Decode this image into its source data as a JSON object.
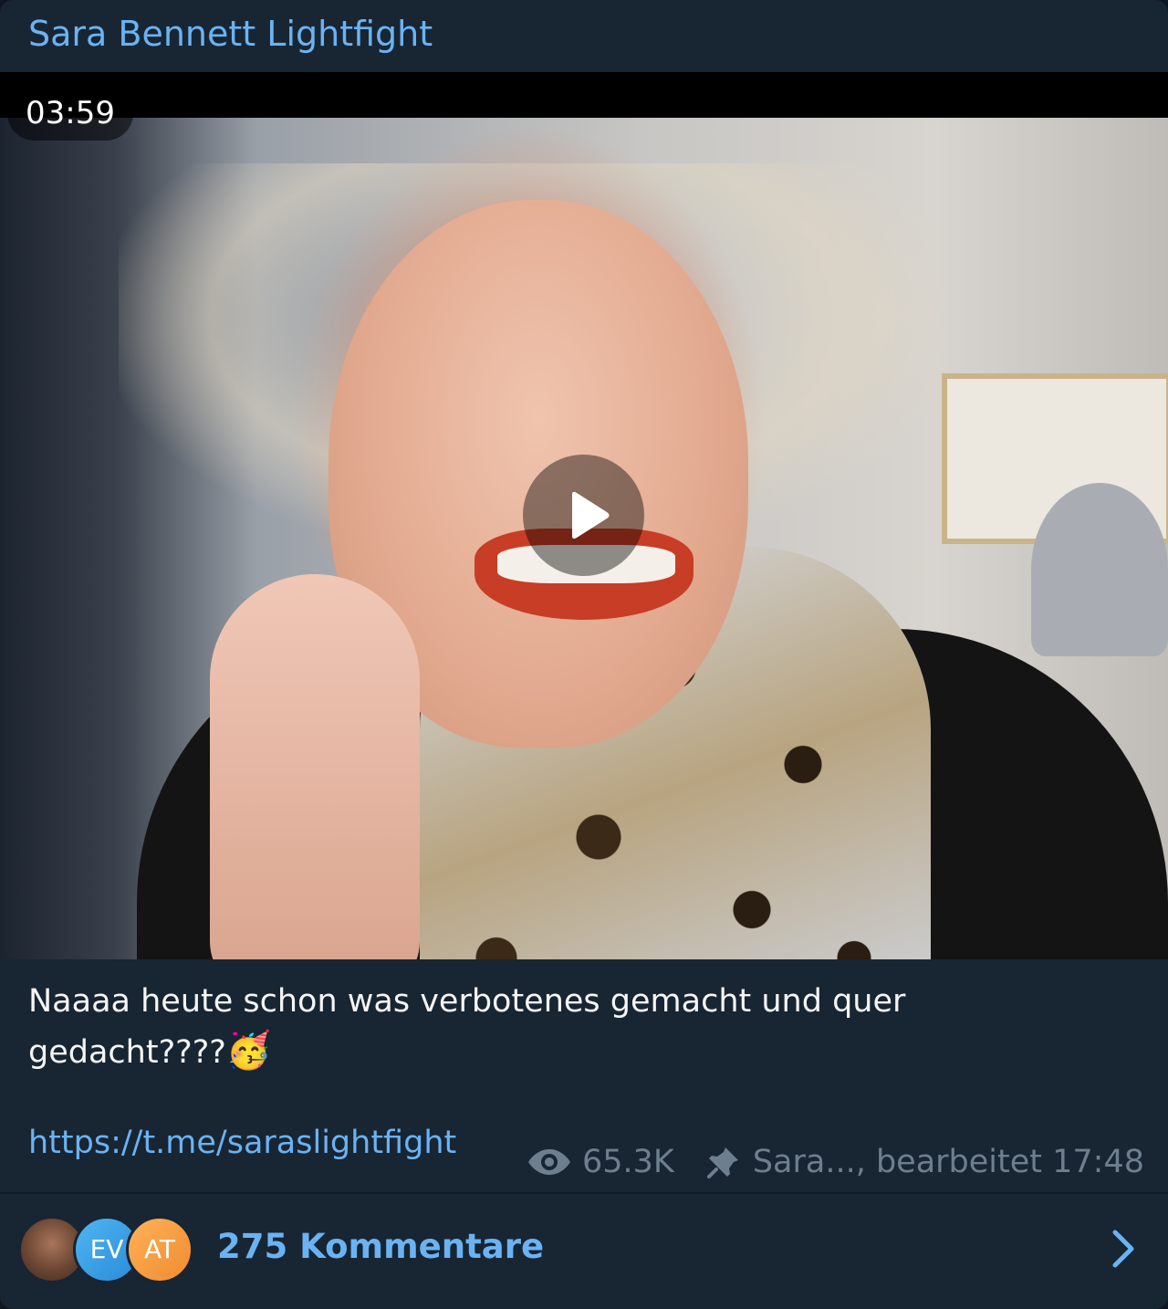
{
  "channel": {
    "title": "Sara Bennett Lightfight"
  },
  "video": {
    "duration": "03:59",
    "play_icon": "play-icon"
  },
  "post": {
    "caption_line1": "Naaaa heute schon was verbotenes gemacht und quer",
    "caption_line2": "gedacht????",
    "caption_emoji": "🥳",
    "link": "https://t.me/saraslightfight"
  },
  "meta": {
    "views": "65.3K",
    "views_icon": "eye-icon",
    "pin_icon": "pin-icon",
    "author_edited": "Sara..., bearbeitet 17:48"
  },
  "comments": {
    "avatars": [
      "EV",
      "AT"
    ],
    "label": "275 Kommentare",
    "chevron_icon": "chevron-right-icon"
  },
  "colors": {
    "accent": "#6ab3f3",
    "card_bg": "#182533",
    "meta_text": "#6d7f8f"
  }
}
